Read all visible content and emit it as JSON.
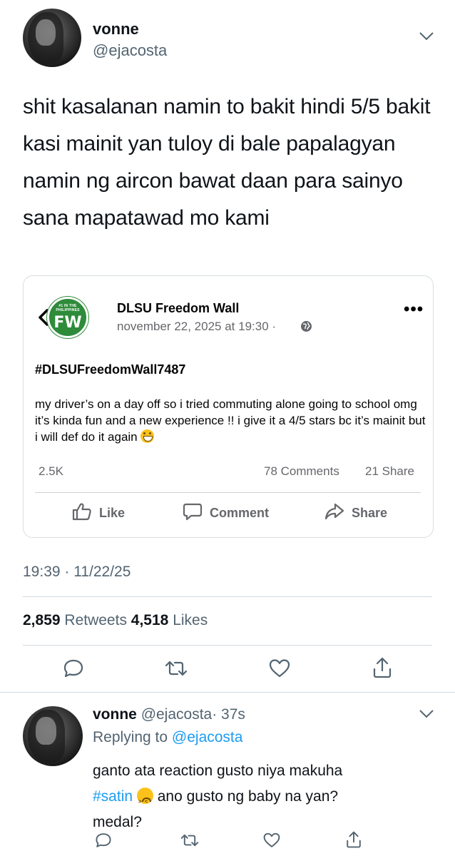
{
  "tweet": {
    "author_name": "vonne",
    "author_handle": "@ejacosta",
    "text": "shit kasalanan namin to bakit hindi 5/5 bakit kasi mainit yan tuloy di bale papalagyan namin ng aircon bawat daan para sainyo sana mapatawad mo kami",
    "timestamp": "19:39 · 11/22/25",
    "retweets_count": "2,859",
    "retweets_label": "Retweets",
    "likes_count": "4,518",
    "likes_label": "Likes"
  },
  "quoted_post": {
    "logo_top": "#1 IN THE PHILIPPINES",
    "logo_text": "FW",
    "page_name": "DLSU Freedom Wall",
    "meta": "november 22, 2025 at 19:30 ·",
    "hashtag": "#DLSUFreedomWall7487",
    "body": "my driver’s on a day off so i tried commuting alone going to school omg it’s kinda fun and a new experience !! i give it a 4/5 stars bc it’s mainit but i will def do it again",
    "reactions": "2.5K",
    "comments": "78 Comments",
    "shares": "21 Share",
    "like_label": "Like",
    "comment_label": "Comment",
    "share_label": "Share"
  },
  "reply": {
    "author_name": "vonne",
    "author_handle": "@ejacosta",
    "time": "· 37s",
    "replying_prefix": "Replying to",
    "replying_handle": "@ejacosta",
    "line1": "ganto ata reaction gusto niya makuha",
    "hashtag": "#satin",
    "line2_rest": " ano gusto ng baby na yan?",
    "line3": "medal?"
  },
  "colors": {
    "text": "#0f1419",
    "secondary": "#536471",
    "link_blue": "#1d9bf0",
    "fw_green": "#2e8b3a"
  }
}
